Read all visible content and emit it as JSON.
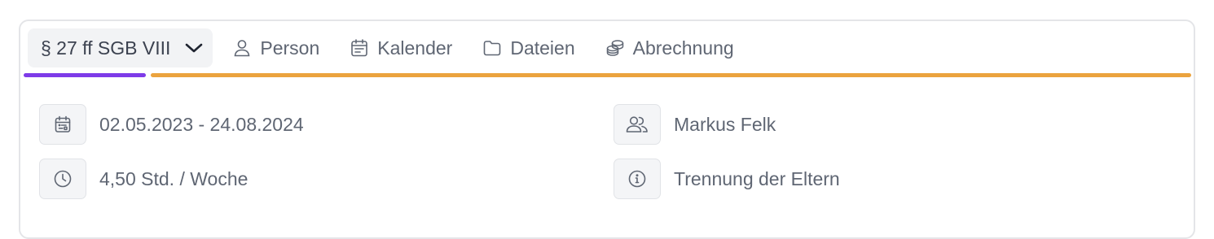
{
  "tabs": {
    "active": {
      "label": "§ 27 ff SGB VIII"
    },
    "items": [
      {
        "label": "Person",
        "icon": "user-icon"
      },
      {
        "label": "Kalender",
        "icon": "calendar-icon"
      },
      {
        "label": "Dateien",
        "icon": "folder-icon"
      },
      {
        "label": "Abrechnung",
        "icon": "coins-icon"
      }
    ]
  },
  "details": {
    "date_range": "02.05.2023 - 24.08.2024",
    "hours": "4,50 Std. / Woche",
    "person": "Markus Felk",
    "reason": "Trennung der Eltern"
  },
  "colors": {
    "active_underline": "#7e3be8",
    "tab_underline": "#eba33e"
  }
}
